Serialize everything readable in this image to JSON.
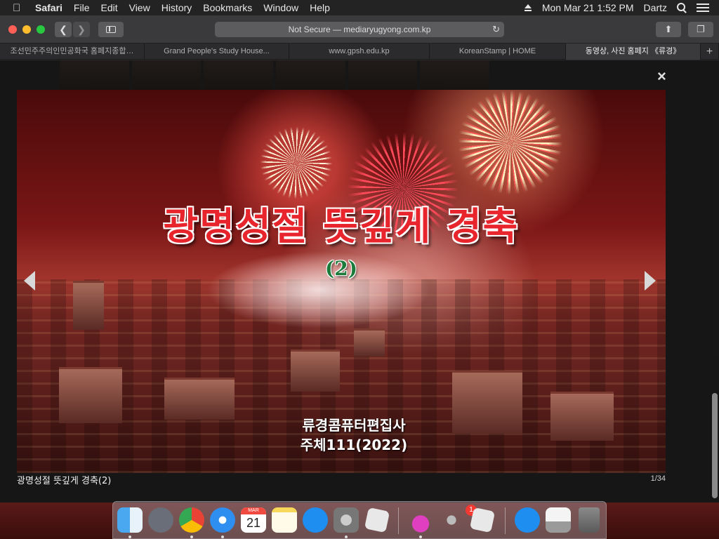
{
  "menubar": {
    "app_name": "Safari",
    "items": [
      "File",
      "Edit",
      "View",
      "History",
      "Bookmarks",
      "Window",
      "Help"
    ],
    "datetime": "Mon Mar 21  1:52 PM",
    "user": "Dartz"
  },
  "toolbar": {
    "url_text": "Not Secure — mediaryugyong.com.kp"
  },
  "tabs": [
    {
      "title": "조선민주주의인민공화국 홈페지종합…"
    },
    {
      "title": "Grand People's Study House..."
    },
    {
      "title": "www.gpsh.edu.kp"
    },
    {
      "title": "KoreanStamp | HOME"
    },
    {
      "title": "동영상, 사진 홈페지 《류경》",
      "active": true
    }
  ],
  "lightbox": {
    "close_label": "×",
    "image_title": "광명성절 뜻깊게 경축",
    "image_number": "(2)",
    "credit_line1": "류경콤퓨터편집사",
    "credit_line2": "주체111(2022)",
    "caption": "광명성절 뜻깊게 경축(2)",
    "counter": "1/34"
  },
  "dock": {
    "calendar_month": "MAR",
    "calendar_day": "21",
    "badge_count": "1",
    "apps": [
      "finder-icon",
      "launchpad-icon",
      "chrome-icon",
      "safari-icon",
      "calendar-icon",
      "notes-icon",
      "app-store-icon",
      "system-preferences-icon",
      "roblox-icon",
      "installer-icon",
      "keychain-icon",
      "roblox-studio-icon",
      "app-store-2-icon",
      "preview-icon",
      "trash-icon"
    ]
  }
}
